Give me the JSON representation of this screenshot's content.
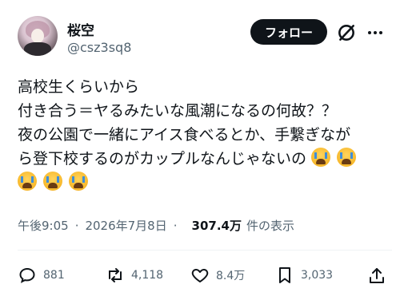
{
  "user": {
    "display_name": "桜空",
    "handle": "@csz3sq8"
  },
  "header": {
    "follow_label": "フォロー"
  },
  "tweet": {
    "lines": [
      "高校生くらいから",
      "付き合う＝ヤるみたいな風潮になるの何故？？",
      "夜の公園で一緒にアイス食べるとか、手繋ぎなが",
      "ら登下校するのがカップルなんじゃないの"
    ],
    "emoji_name": "loudly-crying-face"
  },
  "meta": {
    "time": "午後9:05",
    "date": "2026年7月8日",
    "separator": "·",
    "views": "307.4万",
    "views_label": "件の表示"
  },
  "actions": {
    "replies": "881",
    "reposts": "4,118",
    "likes": "8.4万",
    "bookmarks": "3,033"
  },
  "colors": {
    "text": "#0f1419",
    "secondary": "#536471",
    "button": "#0f1419"
  }
}
